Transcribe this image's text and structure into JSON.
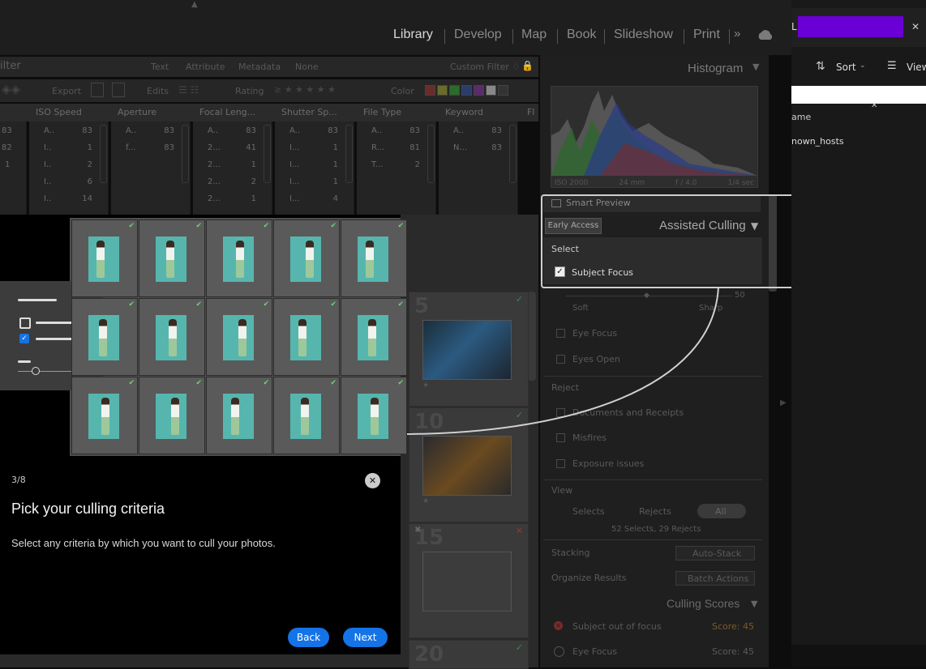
{
  "modules": [
    "Library",
    "Develop",
    "Map",
    "Book",
    "Slideshow",
    "Print"
  ],
  "filter_bar": {
    "title": "ilter",
    "tabs": [
      "Text",
      "Attribute",
      "Metadata",
      "None"
    ],
    "preset": "Custom Filter ♢"
  },
  "toolbar": {
    "export": "Export",
    "edits": "Edits",
    "rating": "Rating",
    "color": "Color"
  },
  "columns": [
    {
      "header": "ISO Speed",
      "rows": [
        [
          "A..",
          "83"
        ],
        [
          "I..",
          "1"
        ],
        [
          "I..",
          "2"
        ],
        [
          "I..",
          "6"
        ],
        [
          "I..",
          "14"
        ]
      ]
    },
    {
      "header": "Aperture",
      "rows": [
        [
          "A..",
          "83"
        ],
        [
          "f...",
          "83"
        ]
      ]
    },
    {
      "header": "Focal Leng...",
      "rows": [
        [
          "A..",
          "83"
        ],
        [
          "2...",
          "41"
        ],
        [
          "2...",
          "1"
        ],
        [
          "2...",
          "2"
        ],
        [
          "2...",
          "1"
        ]
      ]
    },
    {
      "header": "Shutter Sp...",
      "rows": [
        [
          "A..",
          "83"
        ],
        [
          "I...",
          "1"
        ],
        [
          "I...",
          "1"
        ],
        [
          "I...",
          "1"
        ],
        [
          "I...",
          "4"
        ]
      ]
    },
    {
      "header": "File Type",
      "rows": [
        [
          "A..",
          "83"
        ],
        [
          "R...",
          "81"
        ],
        [
          "T...",
          "2"
        ]
      ]
    },
    {
      "header": "Keyword",
      "rows": [
        [
          "A..",
          "83"
        ],
        [
          "N...",
          "83"
        ]
      ]
    }
  ],
  "left_stub_rows": [
    "83",
    "82",
    "1"
  ],
  "grid_numbers": [
    "5",
    "10",
    "15",
    "20"
  ],
  "right_panel": {
    "histogram": "Histogram",
    "hist_info": [
      "ISO 2000",
      "24 mm",
      "f / 4.0",
      "1/4 sec"
    ],
    "smart_preview": "Smart Preview",
    "early_access": "Early Access",
    "assisted_culling": "Assisted Culling",
    "select_label": "Select",
    "subject_focus": "Subject Focus",
    "soft": "Soft",
    "sharp": "Sharp",
    "slider_value": "50",
    "eye_focus": "Eye Focus",
    "eyes_open": "Eyes Open",
    "reject_label": "Reject",
    "reject_items": [
      "Documents and Receipts",
      "Misfires",
      "Exposure issues"
    ],
    "view_label": "View",
    "view_buttons": [
      "Selects",
      "Rejects",
      "All"
    ],
    "view_summary": "52 Selects, 29 Rejects",
    "stacking": "Stacking",
    "auto_stack": "Auto-Stack",
    "organize": "Organize Results",
    "batch": "Batch Actions",
    "culling_scores": "Culling Scores",
    "score_items": [
      {
        "label": "Subject out of focus",
        "score": "Score: 45"
      },
      {
        "label": "Eye Focus",
        "score": "Score: 45"
      }
    ]
  },
  "right_window": {
    "title": "L",
    "sort": "Sort",
    "view": "View",
    "name_col": "ame",
    "file": "nown_hosts"
  },
  "onboarding": {
    "step": "3/8",
    "title": "Pick your culling criteria",
    "body": "Select any criteria by which you want to cull your photos.",
    "back": "Back",
    "next": "Next"
  },
  "colors": {
    "accent": "#1473e6",
    "redact": "#6a00d6",
    "check": "#6fd07a"
  }
}
